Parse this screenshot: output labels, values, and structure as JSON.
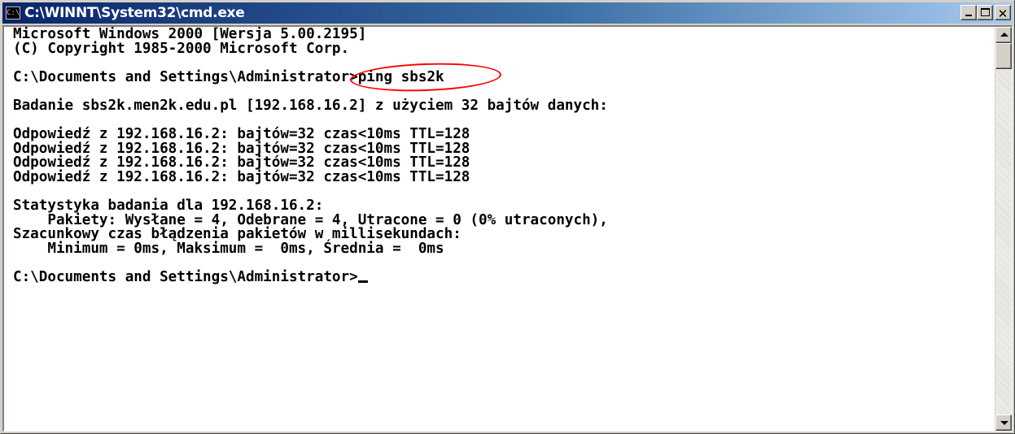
{
  "window": {
    "title": "C:\\WINNT\\System32\\cmd.exe",
    "icon": "cmd-icon",
    "icon_text": "C:\\",
    "controls": {
      "minimize": "minimize-icon",
      "maximize": "maximize-icon",
      "close_glyph": "✕"
    }
  },
  "console": {
    "lines": [
      "Microsoft Windows 2000 [Wersja 5.00.2195]",
      "(C) Copyright 1985-2000 Microsoft Corp.",
      "",
      "",
      "",
      "Badanie sbs2k.men2k.edu.pl [192.168.16.2] z użyciem 32 bajtów danych:",
      "",
      "Odpowiedź z 192.168.16.2: bajtów=32 czas<10ms TTL=128",
      "Odpowiedź z 192.168.16.2: bajtów=32 czas<10ms TTL=128",
      "Odpowiedź z 192.168.16.2: bajtów=32 czas<10ms TTL=128",
      "Odpowiedź z 192.168.16.2: bajtów=32 czas<10ms TTL=128",
      "",
      "Statystyka badania dla 192.168.16.2:",
      "    Pakiety: Wysłane = 4, Odebrane = 4, Utracone = 0 (0% utraconych),",
      "Szacunkowy czas błądzenia pakietów w millisekundach:",
      "    Minimum = 0ms, Maksimum =  0ms, Średnia =  0ms",
      ""
    ],
    "command_prompt": "C:\\Documents and Settings\\Administrator>",
    "command_text": "ping sbs2k",
    "final_prompt": "C:\\Documents and Settings\\Administrator>",
    "highlight_color": "#ff0000"
  },
  "colors": {
    "titlebar_start": "#0a246a",
    "titlebar_end": "#a6caf0",
    "console_bg": "#ffffff",
    "console_text": "#000000"
  }
}
